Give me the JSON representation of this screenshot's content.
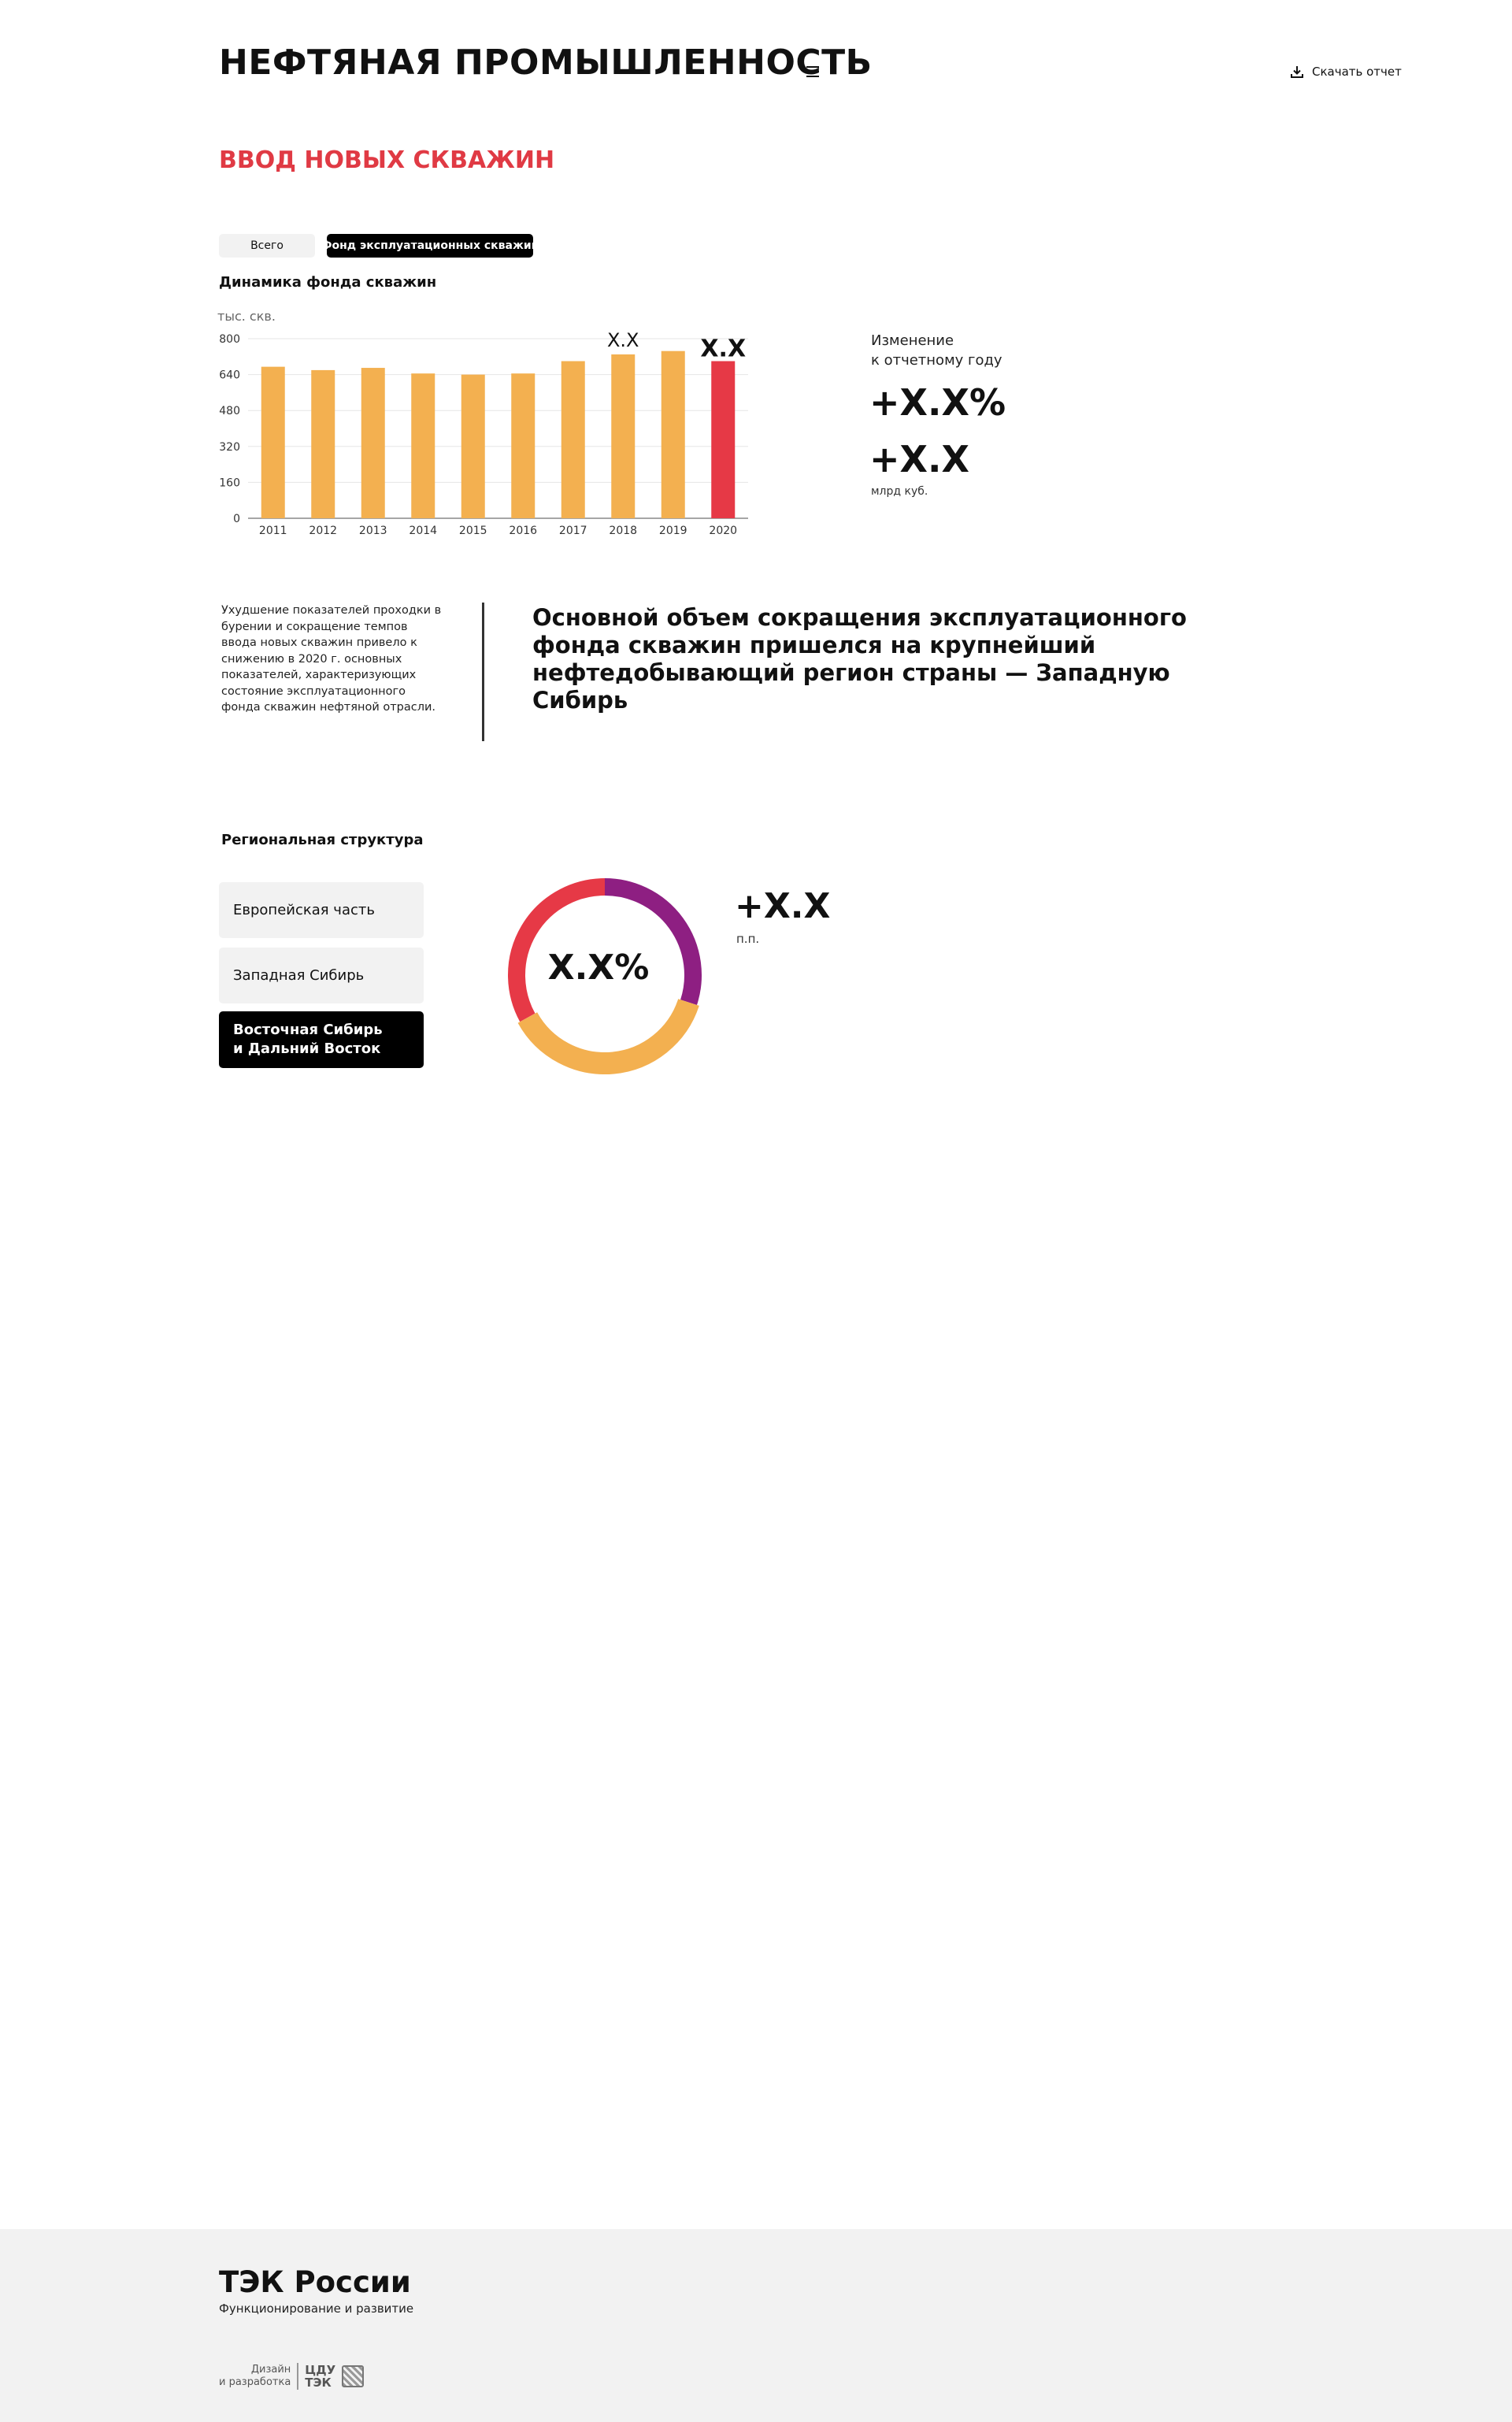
{
  "header": {
    "title": "НЕФТЯНАЯ ПРОМЫШЛЕННОСТЬ",
    "download_label": "Скачать отчет"
  },
  "section": {
    "title": "ВВОД НОВЫХ СКВАЖИН"
  },
  "tabs": [
    {
      "label": "Всего",
      "active": false
    },
    {
      "label": "Фонд эксплуатационных скважин",
      "active": true
    }
  ],
  "chart_title": "Динамика фонда скважин",
  "chart_data": {
    "type": "bar",
    "title": "Динамика фонда скважин",
    "ylabel": "тыс. скв.",
    "xlabel": "",
    "categories": [
      "2011",
      "2012",
      "2013",
      "2014",
      "2015",
      "2016",
      "2017",
      "2018",
      "2019",
      "2020"
    ],
    "values": [
      675,
      660,
      670,
      645,
      640,
      645,
      700,
      730,
      745,
      700
    ],
    "highlight_index": 9,
    "highlight_color": "#e63946",
    "bar_color": "#f3b050",
    "ylim": [
      0,
      800
    ],
    "yticks": [
      0,
      160,
      320,
      480,
      640,
      800
    ],
    "data_labels": [
      {
        "index": 7,
        "text": "X.X"
      },
      {
        "index": 9,
        "text": "X.X"
      }
    ],
    "grid": true
  },
  "change": {
    "label_line1": "Изменение",
    "label_line2": "к отчетному году",
    "percent": "+X.X%",
    "absolute": "+X.X",
    "unit": "млрд куб."
  },
  "note": "Ухудшение показателей проходки в бурении и сокращение темпов ввода новых скважин привело к снижению в 2020 г. основных показателей, характеризующих состояние эксплуатационного фонда скважин нефтяной отрасли.",
  "quote": "Основной объем сокращения эксплуатационного фонда скважин пришелся на крупнейший нефтедобывающий регион страны — Западную Сибирь",
  "regions": {
    "title": "Региональная структура",
    "buttons": [
      {
        "label": "Европейская часть",
        "active": false
      },
      {
        "label": "Западная Сибирь",
        "active": false
      },
      {
        "label": "Восточная Сибирь\nи Дальний Восток",
        "active": true
      }
    ],
    "donut": {
      "center_label": "X.X%",
      "change": "+X.X",
      "unit": "п.п.",
      "segments": [
        {
          "color": "#8e1f82",
          "share": 0.3
        },
        {
          "color": "#f3b050",
          "share": 0.37
        },
        {
          "color": "#e63946",
          "share": 0.33
        }
      ]
    }
  },
  "footer": {
    "title": "ТЭК России",
    "subtitle": "Функционирование и развитие",
    "credit_text": "Дизайн\nи разработка",
    "credit_logo": "ЦДУ\nТЭК"
  },
  "colors": {
    "accent": "#e03a44",
    "bar": "#f3b050",
    "highlight": "#e63946",
    "purple": "#8e1f82"
  }
}
